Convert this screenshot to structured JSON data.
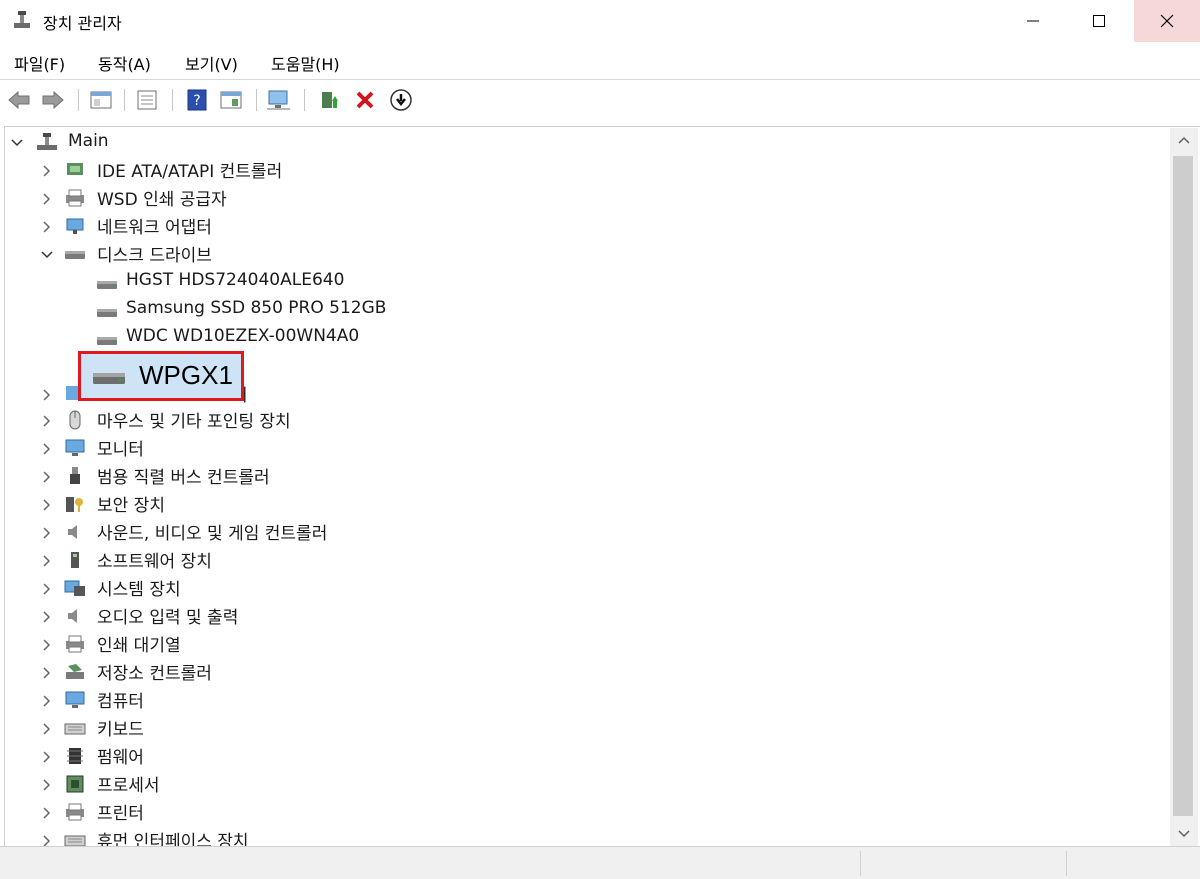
{
  "window": {
    "title": "장치 관리자"
  },
  "menu": {
    "items": [
      {
        "label": "파일(F)"
      },
      {
        "label": "동작(A)"
      },
      {
        "label": "보기(V)"
      },
      {
        "label": "도움말(H)"
      }
    ]
  },
  "toolbar": {
    "buttons": [
      "back-icon",
      "forward-icon",
      "show-hide-tree-icon",
      "properties-icon",
      "help-icon",
      "action-pane-icon",
      "scan-hardware-icon",
      "update-driver-icon",
      "uninstall-icon",
      "enable-device-icon"
    ]
  },
  "tree": {
    "root": "Main",
    "disk_children": [
      "HGST HDS724040ALE640",
      "Samsung SSD 850 PRO 512GB",
      "WDC WD10EZEX-00WN4A0"
    ],
    "categories": [
      "IDE ATA/ATAPI 컨트롤러",
      "WSD 인쇄 공급자",
      "네트워크 어댑터",
      "디스크 드라이브",
      "마우스 및 기타 포인팅 장치",
      "모니터",
      "범용 직렬 버스 컨트롤러",
      "보안 장치",
      "사운드, 비디오 및 게임 컨트롤러",
      "소프트웨어 장치",
      "시스템 장치",
      "오디오 입력 및 출력",
      "인쇄 대기열",
      "저장소 컨트롤러",
      "컴퓨터",
      "키보드",
      "펌웨어",
      "프로세서",
      "프린터",
      "휴먼 인터페이스 장치"
    ],
    "hidden_row_partial": "러",
    "callout_label": "WPGX1"
  },
  "colors": {
    "selection": "#cfe3f7",
    "callout_border": "#e0191f",
    "close_hover": "#f6d8d9"
  }
}
